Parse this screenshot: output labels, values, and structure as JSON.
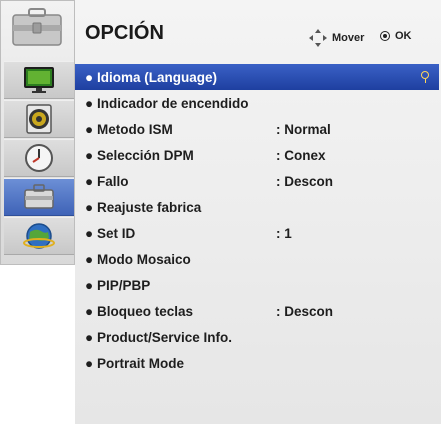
{
  "menu": {
    "title": "OPCIÓN",
    "hints": {
      "move_label": "Mover",
      "ok_label": "OK"
    }
  },
  "sidebar": {
    "items": [
      {
        "icon": "monitor-icon",
        "selected": false
      },
      {
        "icon": "speaker-icon",
        "selected": false
      },
      {
        "icon": "clock-icon",
        "selected": false
      },
      {
        "icon": "toolbox-icon",
        "selected": true
      },
      {
        "icon": "network-globe-icon",
        "selected": false
      }
    ]
  },
  "items": [
    {
      "label": "Idioma (Language)",
      "value": "",
      "selected": true
    },
    {
      "label": "Indicador de encendido",
      "value": ""
    },
    {
      "label": "Metodo ISM",
      "value": ": Normal"
    },
    {
      "label": "Selección DPM",
      "value": ": Conex"
    },
    {
      "label": "Fallo",
      "value": ": Descon"
    },
    {
      "label": "Reajuste fabrica",
      "value": ""
    },
    {
      "label": "Set ID",
      "value": ": 1"
    },
    {
      "label": "Modo Mosaico",
      "value": ""
    },
    {
      "label": "PIP/PBP",
      "value": ""
    },
    {
      "label": "Bloqueo teclas",
      "value": ": Descon"
    },
    {
      "label": "Product/Service Info.",
      "value": ""
    },
    {
      "label": "Portrait Mode",
      "value": ""
    }
  ],
  "colors": {
    "selection": "#2a4db3",
    "indicator": "#ffd75a",
    "sidebar_active": "#4a6fc2"
  }
}
